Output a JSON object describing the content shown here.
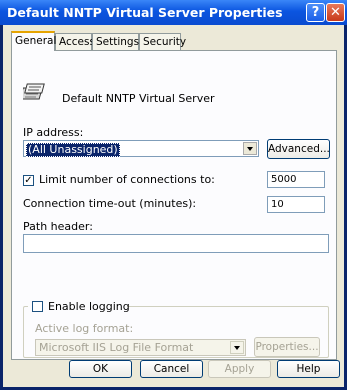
{
  "window": {
    "title": "Default NNTP Virtual Server Properties",
    "help_glyph": "?",
    "close_glyph": "✕"
  },
  "tabs": [
    {
      "label": "General"
    },
    {
      "label": "Access"
    },
    {
      "label": "Settings"
    },
    {
      "label": "Security"
    }
  ],
  "general": {
    "server_name": "Default NNTP Virtual Server",
    "ip_label": "IP address:",
    "ip_value": "(All Unassigned)",
    "advanced_label": "Advanced...",
    "limit_label": "Limit number of connections to:",
    "limit_checked": "✓",
    "limit_value": "5000",
    "timeout_label": "Connection time-out (minutes):",
    "timeout_value": "10",
    "path_label": "Path header:",
    "path_value": "",
    "logging_label": "Enable logging",
    "log_format_label": "Active log format:",
    "log_format_value": "Microsoft IIS Log File Format",
    "properties_label": "Properties..."
  },
  "footer": {
    "ok_label": "OK",
    "cancel_label": "Cancel",
    "apply_label": "Apply",
    "help_label": "Help"
  }
}
